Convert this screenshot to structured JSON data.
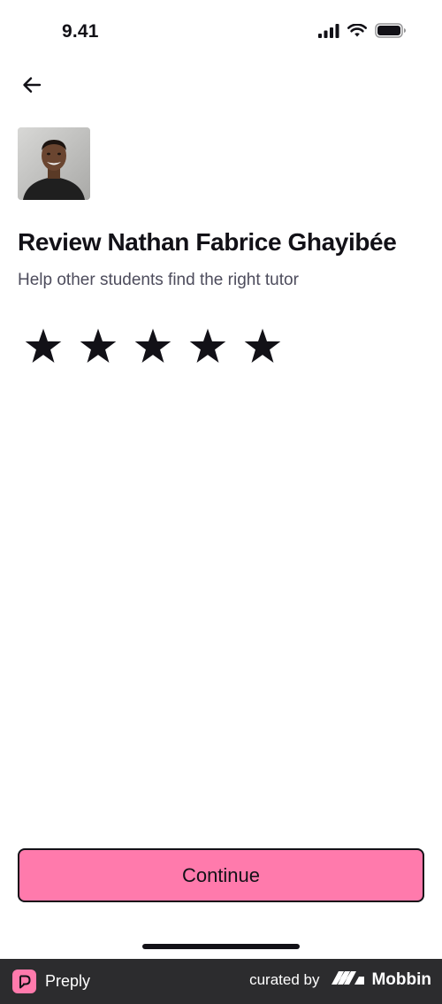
{
  "status_bar": {
    "time": "9.41",
    "icons": [
      "cellular-signal-icon",
      "wifi-icon",
      "battery-icon"
    ]
  },
  "header": {
    "back_icon": "arrow-left-icon"
  },
  "tutor": {
    "avatar_alt": "tutor-photo"
  },
  "main": {
    "title": "Review Nathan Fabrice Ghayibée",
    "subtitle": "Help other students find the right tutor",
    "rating": {
      "max": 5,
      "selected": 0,
      "star_icon": "star-icon"
    }
  },
  "actions": {
    "continue_label": "Continue"
  },
  "footer": {
    "brand": "Preply",
    "curated_label": "curated by",
    "curator": "Mobbin"
  },
  "colors": {
    "accent": "#ff7aac",
    "text": "#121117",
    "subtext": "#4d4c5c",
    "footer_bg": "#2c2c2e"
  }
}
